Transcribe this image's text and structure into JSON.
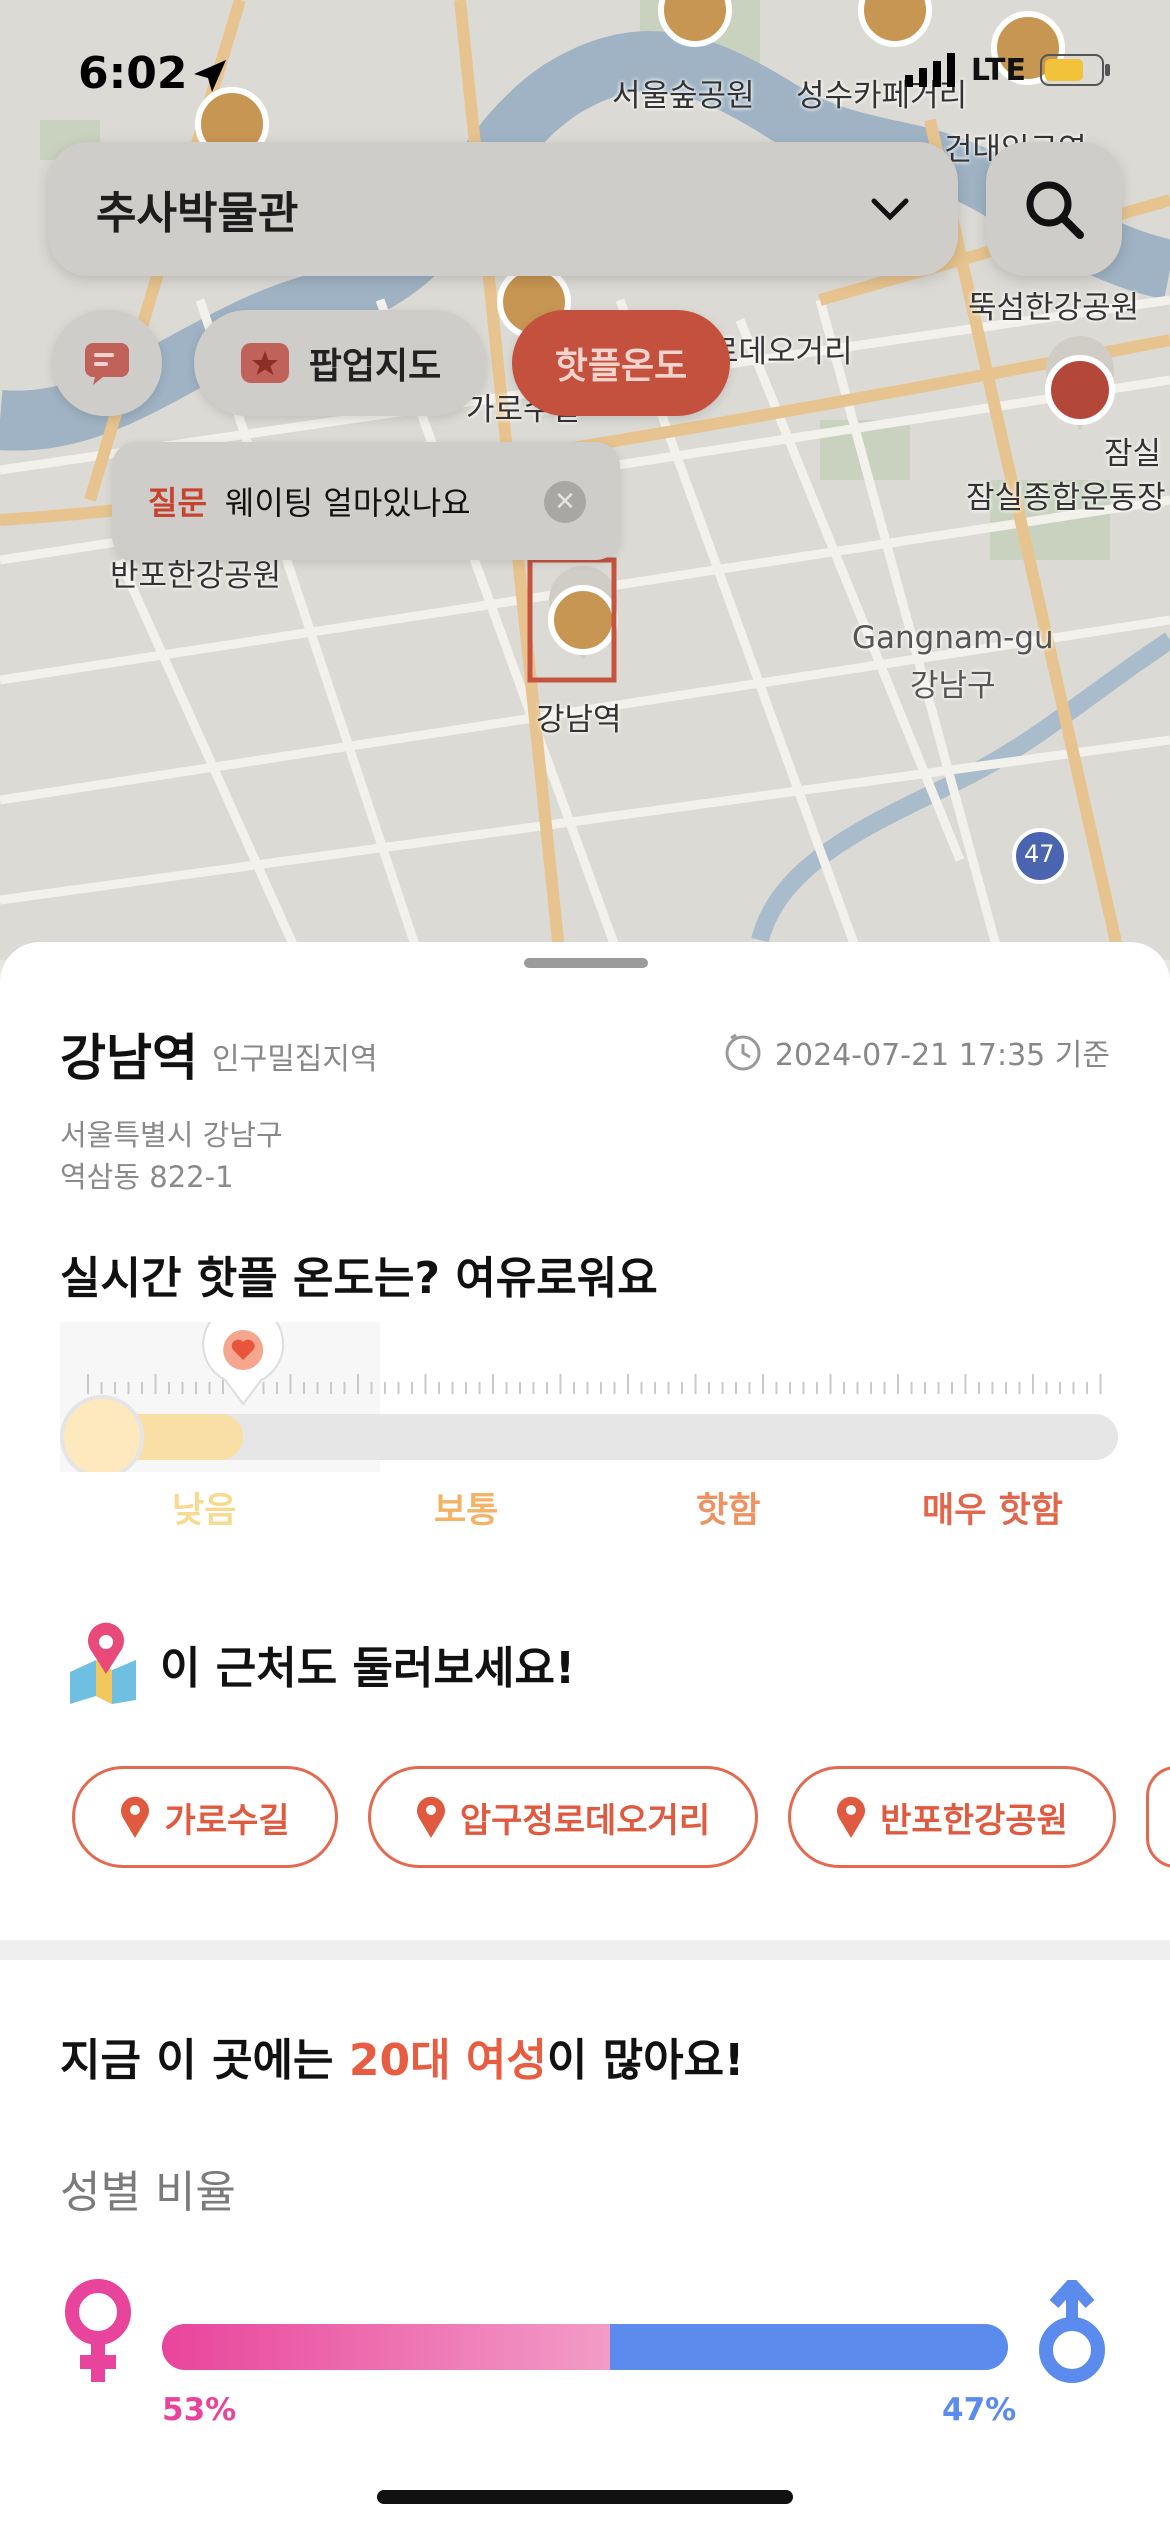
{
  "status_bar": {
    "time": "6:02",
    "network": "LTE"
  },
  "search": {
    "query": "추사박물관"
  },
  "filters": [
    {
      "label": "",
      "icon": "chat-icon"
    },
    {
      "label": "팝업지도",
      "icon": "star-badge-icon"
    },
    {
      "label": "핫플온도",
      "active": true
    }
  ],
  "tooltip": {
    "tag": "질문",
    "text": "웨이팅 얼마있나요"
  },
  "map_labels": [
    "서울숲공원",
    "성수카페거리",
    "건대입구역",
    "뚝섬한강공원",
    "로데오거리",
    "가로수길",
    "잠실",
    "잠실종합운동장",
    "반포한강공원",
    "Gangnam-gu",
    "강남구",
    "강남역",
    "47"
  ],
  "place": {
    "name": "강남역",
    "category": "인구밀집지역",
    "updated": "2024-07-21 17:35 기준",
    "address_line1": "서울특별시 강남구",
    "address_line2": "역삼동 822-1"
  },
  "temperature": {
    "title": "실시간 핫플 온도는? 여유로워요",
    "level": 0.17,
    "scale": [
      {
        "label": "낮음",
        "color": "#f7d98f"
      },
      {
        "label": "보통",
        "color": "#f4b265"
      },
      {
        "label": "핫함",
        "color": "#ee9260"
      },
      {
        "label": "매우 핫함",
        "color": "#e3664c"
      }
    ]
  },
  "nearby": {
    "title": "이 근처도 둘러보세요!",
    "places": [
      "가로수길",
      "압구정로데오거리",
      "반포한강공원"
    ]
  },
  "demographics": {
    "title_prefix": "지금 이 곳에는 ",
    "title_highlight": "20대 여성",
    "title_suffix": "이 많아요!",
    "subtitle": "성별 비율",
    "female_pct": 53,
    "male_pct": 47,
    "female_label": "53%",
    "male_label": "47%",
    "female_color": "#e9449b",
    "male_color": "#5b8bec"
  },
  "colors": {
    "accent": "#e85c41"
  }
}
